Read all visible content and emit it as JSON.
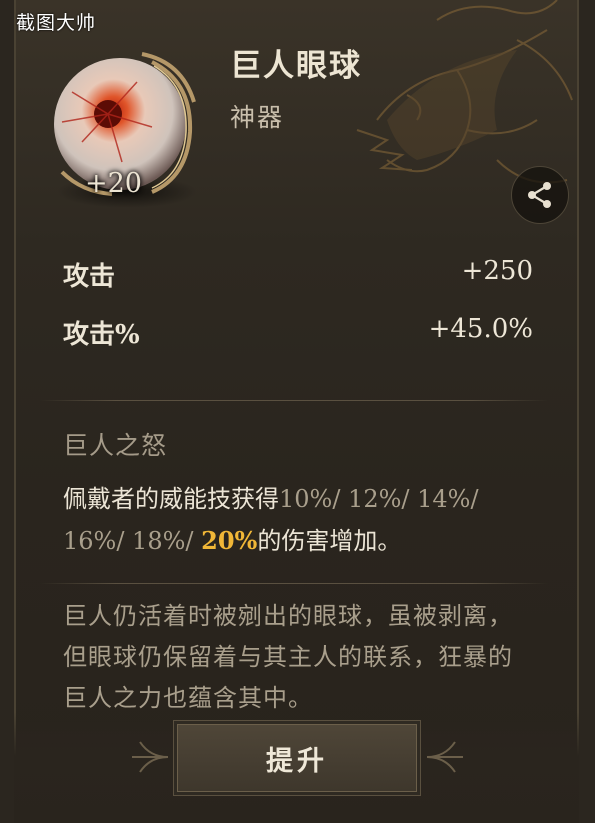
{
  "watermark": "截图大帅",
  "item": {
    "name": "巨人眼球",
    "type": "神器",
    "level": "+20",
    "icon": "giant-eyeball-icon"
  },
  "share": {
    "icon": "share-icon"
  },
  "stats": [
    {
      "label": "攻击",
      "value": "+250"
    },
    {
      "label": "攻击%",
      "value": "+45.0%"
    }
  ],
  "skill": {
    "title": "巨人之怒",
    "desc_prefix": "佩戴者的威能技获得",
    "desc_tiers": "10%/ 12%/ 14%/ 16%/ 18%/ ",
    "desc_highlight": "20%",
    "desc_suffix": "的伤害增加。"
  },
  "lore": "巨人仍活着时被剜出的眼球，虽被剥离，但眼球仍保留着与其主人的联系，狂暴的巨人之力也蕴含其中。",
  "buttons": {
    "upgrade": "提升"
  },
  "colors": {
    "highlight": "#f1b737",
    "text": "#ede6d6",
    "muted": "#a99f8c"
  }
}
